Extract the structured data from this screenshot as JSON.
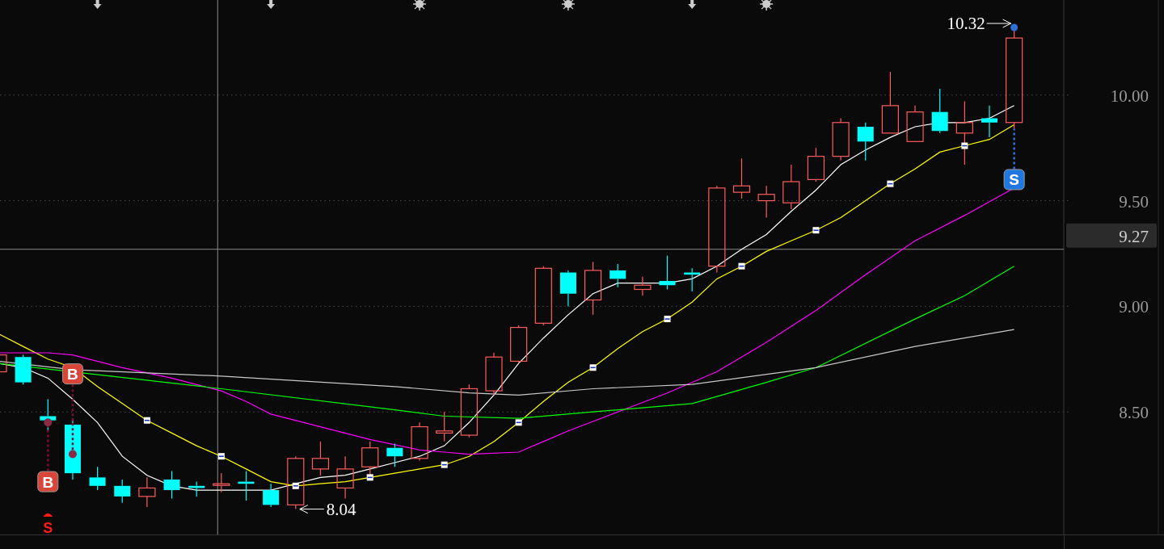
{
  "chart": {
    "events": [
      {
        "kind": "arrow"
      },
      {
        "kind": "arrow"
      },
      {
        "kind": "gear"
      },
      {
        "kind": "gear"
      },
      {
        "kind": "arrow"
      },
      {
        "kind": "gear"
      }
    ],
    "high_label": "10.32",
    "low_label": "8.04",
    "signals": [
      {
        "kind": "buy",
        "text": "B"
      },
      {
        "kind": "buy",
        "text": "B"
      },
      {
        "kind": "sell_hint",
        "text": "S"
      },
      {
        "kind": "sell",
        "text": "S"
      }
    ]
  },
  "price_axis": {
    "labels": [
      "10.00",
      "9.50",
      "9.00",
      "8.50"
    ],
    "cursor_label": "9.27"
  }
}
